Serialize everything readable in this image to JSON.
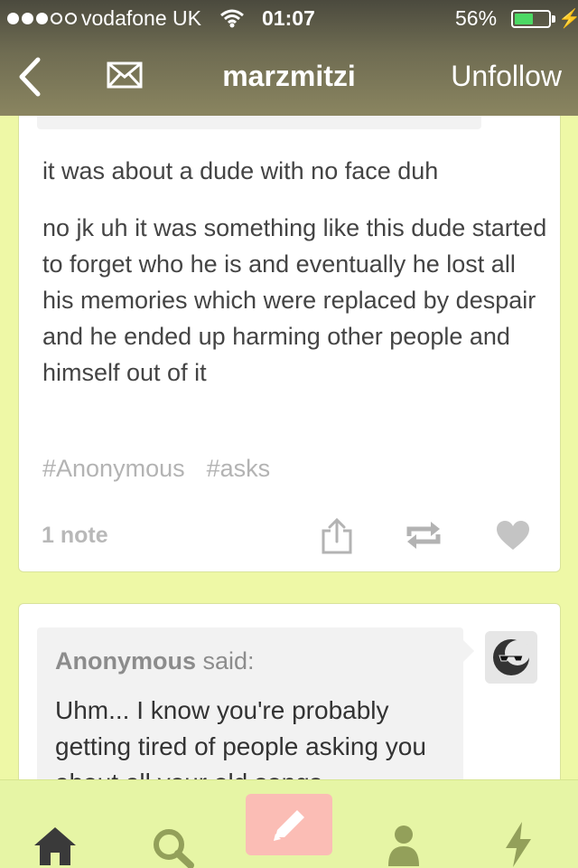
{
  "status_bar": {
    "carrier": "vodafone UK",
    "time": "01:07",
    "battery_percent_label": "56%",
    "battery_level": 0.56,
    "signal_bars_filled": 3,
    "signal_bars_total": 5
  },
  "header": {
    "blog_name": "marzmitzi",
    "unfollow_label": "Unfollow"
  },
  "post1": {
    "paragraphs": [
      "it was about a dude with no face duh",
      "no jk uh it was something like this dude started to forget who he is and eventually he lost all his memories which were replaced by despair and he ended up harming other people and himself out of it"
    ],
    "tags": [
      "#Anonymous",
      "#asks"
    ],
    "notes": "1 note"
  },
  "post2": {
    "asker": "Anonymous",
    "said": " said:",
    "question": "Uhm... I know you're probably getting tired of people asking you about all your old songs"
  },
  "colors": {
    "background": "#eef8a6",
    "tabbar": "#e6f5a5",
    "compose_button": "#fbbdb5",
    "tab_icon": "#93a05a",
    "battery_fill": "#4cd964"
  },
  "icons": {
    "back": "chevron-left-icon",
    "mail": "envelope-icon",
    "share": "share-icon",
    "reblog": "reblog-icon",
    "like": "heart-icon",
    "home": "home-icon",
    "search": "search-icon",
    "compose": "pencil-icon",
    "account": "person-icon",
    "activity": "lightning-icon"
  }
}
